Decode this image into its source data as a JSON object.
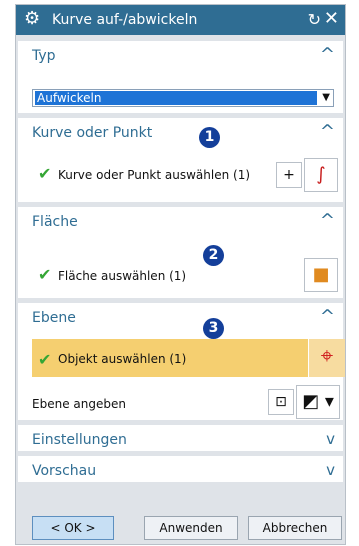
{
  "window": {
    "title": "Kurve auf-/abwickeln",
    "gear_icon": "⚙",
    "reset_icon": "↻",
    "close_icon": "✕"
  },
  "sections": {
    "typ": {
      "title": "Typ",
      "chevron": "^",
      "value": "Aufwickeln",
      "dropdown_arrow": "▼"
    },
    "kurve": {
      "title": "Kurve oder Punkt",
      "chevron": "^",
      "badge": "1",
      "row_label": "Kurve oder Punkt auswählen (1)"
    },
    "flaeche": {
      "title": "Fläche",
      "chevron": "^",
      "badge": "2",
      "row_label": "Fläche auswählen (1)"
    },
    "ebene": {
      "title": "Ebene",
      "chevron": "^",
      "badge": "3",
      "row_label": "Objekt auswählen (1)",
      "row2_label": "Ebene angeben"
    },
    "einstellungen": {
      "title": "Einstellungen",
      "chevron": "v"
    },
    "vorschau": {
      "title": "Vorschau",
      "chevron": "v"
    }
  },
  "buttons": {
    "ok": "< OK >",
    "apply": "Anwenden",
    "cancel": "Abbrechen"
  },
  "colors": {
    "title_bar": "#2f6d93",
    "section_text": "#2f6d93",
    "badge": "#143f9a",
    "highlight": "#f5cf70",
    "check": "#35a635"
  }
}
